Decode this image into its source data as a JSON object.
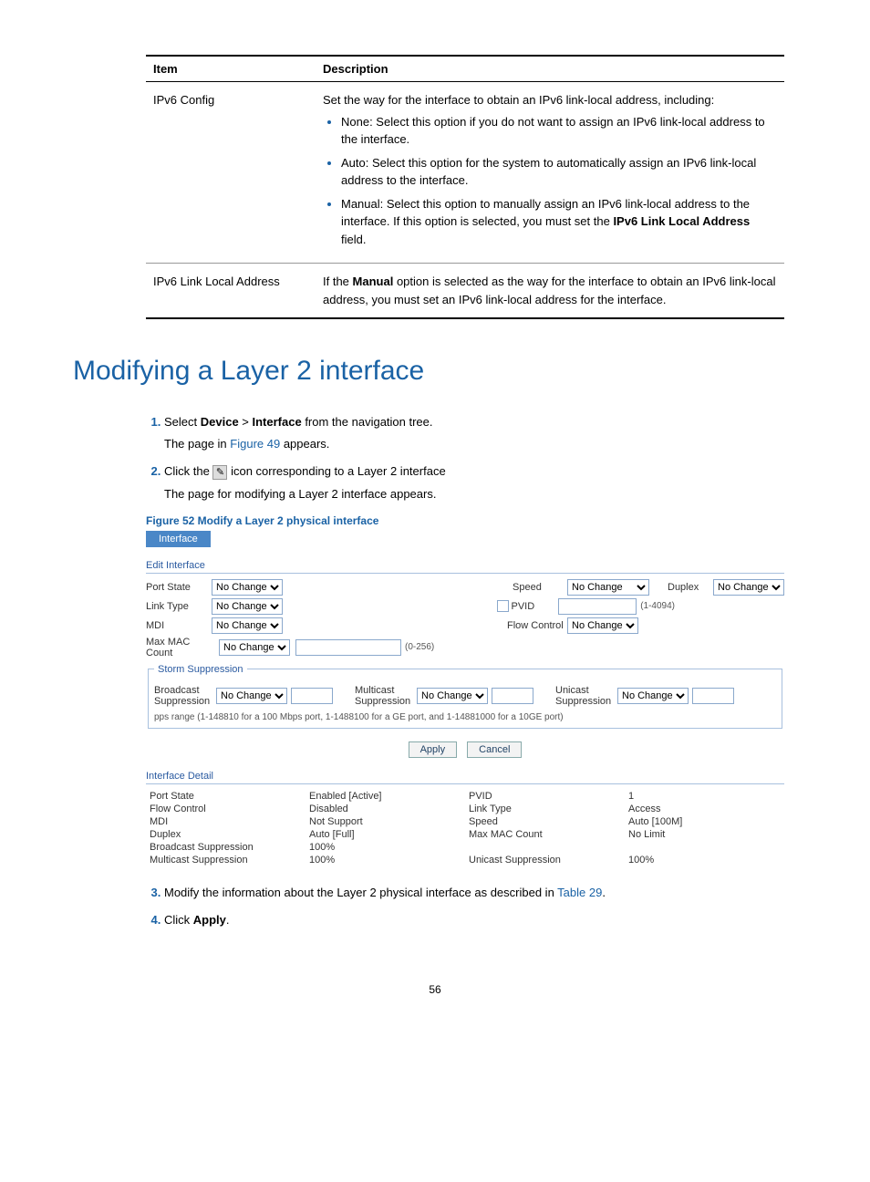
{
  "table": {
    "col1": "Item",
    "col2": "Description",
    "rows": [
      {
        "item": "IPv6 Config",
        "desc_intro": "Set the way for the interface to obtain an IPv6 link-local address, including:",
        "bullets": [
          "None: Select this option if you do not want to assign an IPv6 link-local address to the interface.",
          "Auto: Select this option for the system to automatically assign an IPv6 link-local address to the interface.",
          "Manual: Select this option to manually assign an IPv6 link-local address to the interface. If this option is selected, you must set the IPv6 Link Local Address field."
        ],
        "bullet3_prefix": "Manual: Select this option to manually assign an IPv6 link-local address to the interface. If this option is selected, you must set the ",
        "bullet3_strong": "IPv6 Link Local Address",
        "bullet3_suffix": " field."
      },
      {
        "item": "IPv6 Link Local Address",
        "desc_prefix": "If the ",
        "desc_strong": "Manual",
        "desc_suffix": " option is selected as the way for the interface to obtain an IPv6 link-local address, you must set an IPv6 link-local address for the interface."
      }
    ]
  },
  "heading": "Modifying a Layer 2 interface",
  "steps": {
    "s1a": "Select ",
    "s1b": "Device",
    "s1c": " > ",
    "s1d": "Interface",
    "s1e": " from the navigation tree.",
    "s1sub_a": "The page in ",
    "s1sub_link": "Figure 49",
    "s1sub_b": " appears.",
    "s2a": "Click the ",
    "s2b": " icon corresponding to a Layer 2 interface",
    "s2sub": "The page for modifying a Layer 2 interface appears.",
    "s3a": "Modify the information about the Layer 2 physical interface as described in ",
    "s3link": "Table 29",
    "s3b": ".",
    "s4a": "Click ",
    "s4b": "Apply",
    "s4c": "."
  },
  "fig": "Figure 52 Modify a Layer 2 physical interface",
  "ui": {
    "tab": "Interface",
    "edit_title": "Edit Interface",
    "labels": {
      "port_state": "Port State",
      "link_type": "Link Type",
      "mdi": "MDI",
      "max_mac": "Max MAC Count",
      "speed": "Speed",
      "pvid": "PVID",
      "flow_control": "Flow Control",
      "duplex": "Duplex",
      "bcast": "Broadcast Suppression",
      "mcast": "Multicast Suppression",
      "ucast": "Unicast Suppression"
    },
    "storm_leg": "Storm Suppression",
    "no_change": "No Change",
    "hint_pvid": "(1-4094)",
    "hint_mac": "(0-256)",
    "pps_note": "pps range (1-148810 for a 100 Mbps port, 1-1488100 for a GE port, and 1-14881000 for a 10GE port)",
    "apply": "Apply",
    "cancel": "Cancel",
    "detail_title": "Interface Detail",
    "detail": {
      "port_state_v": "Enabled [Active]",
      "pvid_v": "1",
      "flow_v": "Disabled",
      "link_v": "Access",
      "mdi_v": "Not Support",
      "speed_v": "Auto [100M]",
      "duplex_v": "Auto [Full]",
      "maxmac_v": "No Limit",
      "bcast_v": "100%",
      "mcast_v": "100%",
      "ucast_v": "100%"
    }
  },
  "page": "56"
}
